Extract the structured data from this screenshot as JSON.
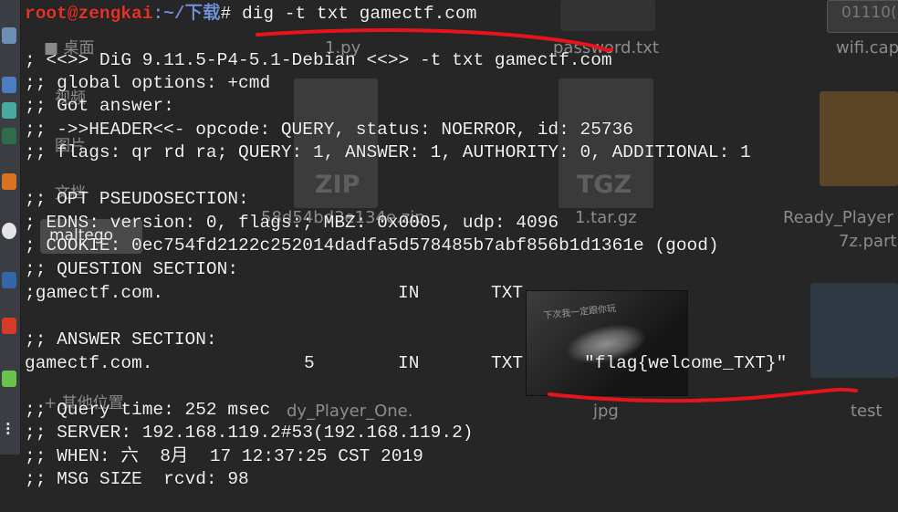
{
  "desktop": {
    "sidebar": [
      "桌面",
      "视频",
      "图片",
      "文档",
      "其他位置"
    ],
    "files": [
      {
        "label": "1.py"
      },
      {
        "label": "password.txt"
      },
      {
        "label": "wifi.cap"
      },
      {
        "label": "58d54bd3e134e.zip",
        "ext": "ZIP"
      },
      {
        "label": "1.tar.gz",
        "ext": "TGZ"
      },
      {
        "label": "Ready_Player",
        "label2": "7z.part"
      },
      {
        "label": "jpg",
        "thumb_text": "下次我一定跟你玩"
      },
      {
        "label": "test"
      },
      {
        "label": "dy_Player_One."
      }
    ],
    "tooltip": "maltego",
    "corner_binary": "01110("
  },
  "terminal": {
    "prompt_user": "root@zengkai",
    "prompt_path": ":~/下载",
    "prompt_symbol": "# ",
    "command": "dig -t txt gamectf.com",
    "lines": [
      "; <<>> DiG 9.11.5-P4-5.1-Debian <<>> -t txt gamectf.com",
      ";; global options: +cmd",
      ";; Got answer:",
      ";; ->>HEADER<<- opcode: QUERY, status: NOERROR, id: 25736",
      ";; flags: qr rd ra; QUERY: 1, ANSWER: 1, AUTHORITY: 0, ADDITIONAL: 1",
      "",
      ";; OPT PSEUDOSECTION:",
      "; EDNS: version: 0, flags:; MBZ: 0x0005, udp: 4096",
      "; COOKIE: 0ec754fd2122c252014dadfa5d578485b7abf856b1d1361e (good)",
      ";; QUESTION SECTION:"
    ],
    "question": {
      "name": ";gamectf.com.",
      "class": "IN",
      "type": "TXT"
    },
    "answer_header": ";; ANSWER SECTION:",
    "answer": {
      "name": "gamectf.com.",
      "ttl": "5",
      "class": "IN",
      "type": "TXT",
      "value": "\"flag{welcome_TXT}\""
    },
    "footer": [
      ";; Query time: 252 msec",
      ";; SERVER: 192.168.119.2#53(192.168.119.2)",
      ";; WHEN: 六  8月  17 12:37:25 CST 2019",
      ";; MSG SIZE  rcvd: 98"
    ]
  },
  "colors": {
    "background": "#262626",
    "text": "#f2f2f2",
    "prompt_user": "#e0352b",
    "prompt_path": "#6f8fd6",
    "annotation_red": "#e8141c"
  }
}
